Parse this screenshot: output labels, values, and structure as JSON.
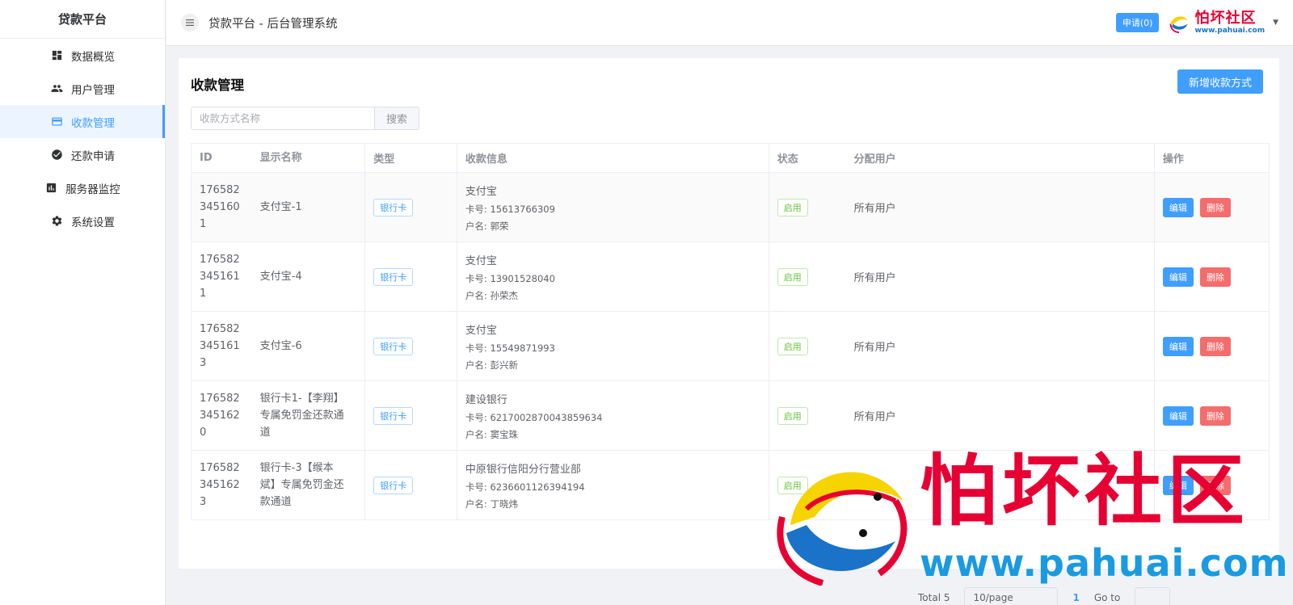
{
  "sidebar": {
    "title": "贷款平台",
    "items": [
      {
        "label": "数据概览",
        "icon": "dashboard-icon"
      },
      {
        "label": "用户管理",
        "icon": "users-icon"
      },
      {
        "label": "收款管理",
        "icon": "card-icon",
        "active": true
      },
      {
        "label": "还款申请",
        "icon": "check-circle-icon"
      },
      {
        "label": "服务器监控",
        "icon": "chart-icon"
      },
      {
        "label": "系统设置",
        "icon": "gear-icon"
      }
    ]
  },
  "header": {
    "title": "贷款平台 - 后台管理系统",
    "apply_label": "申请(0)",
    "logo_cn": "怕坏社区",
    "logo_en": "www.pahuai.com"
  },
  "page": {
    "title": "收款管理",
    "add_button": "新增收款方式",
    "search_placeholder": "收款方式名称",
    "search_button": "搜索"
  },
  "table": {
    "columns": [
      "ID",
      "显示名称",
      "类型",
      "收款信息",
      "状态",
      "分配用户",
      "操作"
    ],
    "rows": [
      {
        "id_lines": [
          "176582",
          "345160",
          "1"
        ],
        "name_lines": [
          "支付宝-1"
        ],
        "type": "银行卡",
        "bank": "支付宝",
        "card": "卡号: 15613766309",
        "holder": "户名: 郭荣",
        "status": "启用",
        "assign": "所有用户"
      },
      {
        "id_lines": [
          "176582",
          "345161",
          "1"
        ],
        "name_lines": [
          "支付宝-4"
        ],
        "type": "银行卡",
        "bank": "支付宝",
        "card": "卡号: 13901528040",
        "holder": "户名: 孙荣杰",
        "status": "启用",
        "assign": "所有用户"
      },
      {
        "id_lines": [
          "176582",
          "345161",
          "3"
        ],
        "name_lines": [
          "支付宝-6"
        ],
        "type": "银行卡",
        "bank": "支付宝",
        "card": "卡号: 15549871993",
        "holder": "户名: 彭兴新",
        "status": "启用",
        "assign": "所有用户"
      },
      {
        "id_lines": [
          "176582",
          "345162",
          "0"
        ],
        "name_lines": [
          "银行卡1-【李翔】",
          "专属免罚金还款通",
          "道"
        ],
        "type": "银行卡",
        "bank": "建设银行",
        "card": "卡号: 6217002870043859634",
        "holder": "户名: 窦宝珠",
        "status": "启用",
        "assign": "所有用户"
      },
      {
        "id_lines": [
          "176582",
          "345162",
          "3"
        ],
        "name_lines": [
          "银行卡-3【缑本",
          "斌】专属免罚金还",
          "款通道"
        ],
        "type": "银行卡",
        "bank": "中原银行信阳分行营业部",
        "card": "卡号: 6236601126394194",
        "holder": "户名: 丁晓炜",
        "status": "启用",
        "assign": ""
      }
    ],
    "edit_label": "编辑",
    "delete_label": "删除"
  },
  "pagination": {
    "total": "Total 5",
    "page_size": "10/page",
    "current": "1",
    "goto": "Go to"
  },
  "watermark": {
    "cn": "怕坏社区",
    "en": "www.pahuai.com"
  },
  "colors": {
    "primary": "#409eff",
    "danger": "#f56c6c",
    "success": "#67c23a",
    "brand_red": "#e60033"
  }
}
